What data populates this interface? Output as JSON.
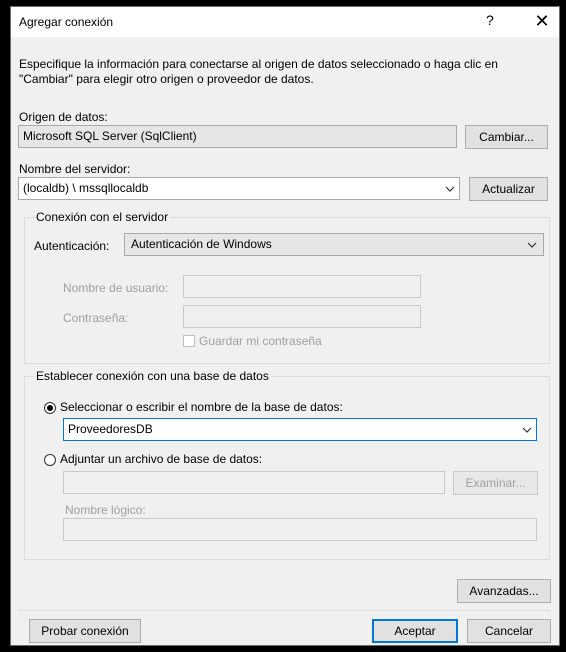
{
  "window": {
    "title": "Agregar conexión",
    "help": "?",
    "close": "✕"
  },
  "description": "Especifique la información para conectarse al origen de datos seleccionado o haga clic en \"Cambiar\" para elegir otro origen o proveedor de datos.",
  "data_source": {
    "label": "Origen de datos:",
    "value": "Microsoft SQL Server (SqlClient)",
    "change_button": "Cambiar..."
  },
  "server": {
    "label": "Nombre del servidor:",
    "value": "(localdb) \\ mssqllocaldb",
    "refresh_button": "Actualizar"
  },
  "server_connection": {
    "group_label": "Conexión con el servidor",
    "auth_label": "Autenticación:",
    "auth_value": "Autenticación de Windows",
    "user_label": "Nombre de usuario:",
    "password_label": "Contraseña:",
    "save_password_label": "Guardar mi contraseña"
  },
  "database_connection": {
    "group_label": "Establecer conexión con una base de datos",
    "select_radio_label": "Seleccionar o escribir el nombre de la base de datos:",
    "database_value": "ProveedoresDB",
    "attach_radio_label": "Adjuntar un archivo de base de datos:",
    "browse_button": "Examinar...",
    "logical_name_label": "Nombre lógico:"
  },
  "buttons": {
    "advanced": "Avanzadas...",
    "test": "Probar conexión",
    "ok": "Aceptar",
    "cancel": "Cancelar"
  },
  "colors": {
    "accent": "#0078d7",
    "dialog_bg": "#f0f0f0",
    "disabled_text": "#a0a0a0"
  },
  "icons": {
    "dropdown": "chevron-down-icon"
  }
}
